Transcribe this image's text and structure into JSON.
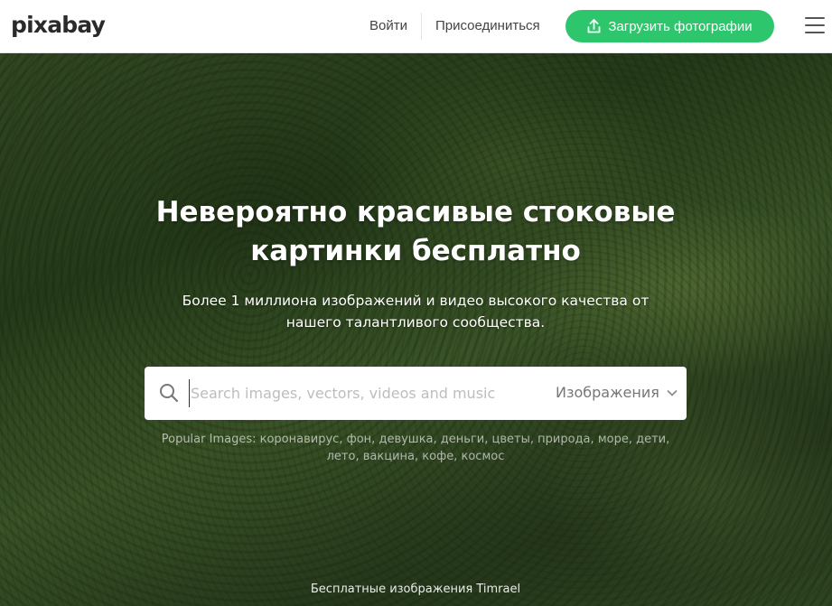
{
  "header": {
    "logo": "pixabay",
    "login_label": "Войти",
    "join_label": "Присоединиться",
    "upload_label": "Загрузить фотографии"
  },
  "hero": {
    "title": "Невероятно красивые стоковые картинки бесплатно",
    "subtitle": "Более 1 миллиона изображений и видео высокого качества от нашего талантливого сообщества.",
    "search": {
      "placeholder": "Search images, vectors, videos and music",
      "type_label": "Изображения"
    },
    "popular": {
      "label": "Popular Images:",
      "tags": [
        "коронавирус",
        "фон",
        "девушка",
        "деньги",
        "цветы",
        "природа",
        "море",
        "дети",
        "лето",
        "вакцина",
        "кофе",
        "космос"
      ]
    },
    "credit": "Бесплатные изображения Timrael"
  },
  "colors": {
    "accent": "#2ec66d",
    "header_bg": "#ffffff",
    "text_dark": "#2a2a2a"
  },
  "icons": [
    "upload-icon",
    "menu-icon",
    "search-icon",
    "chevron-down-icon"
  ]
}
